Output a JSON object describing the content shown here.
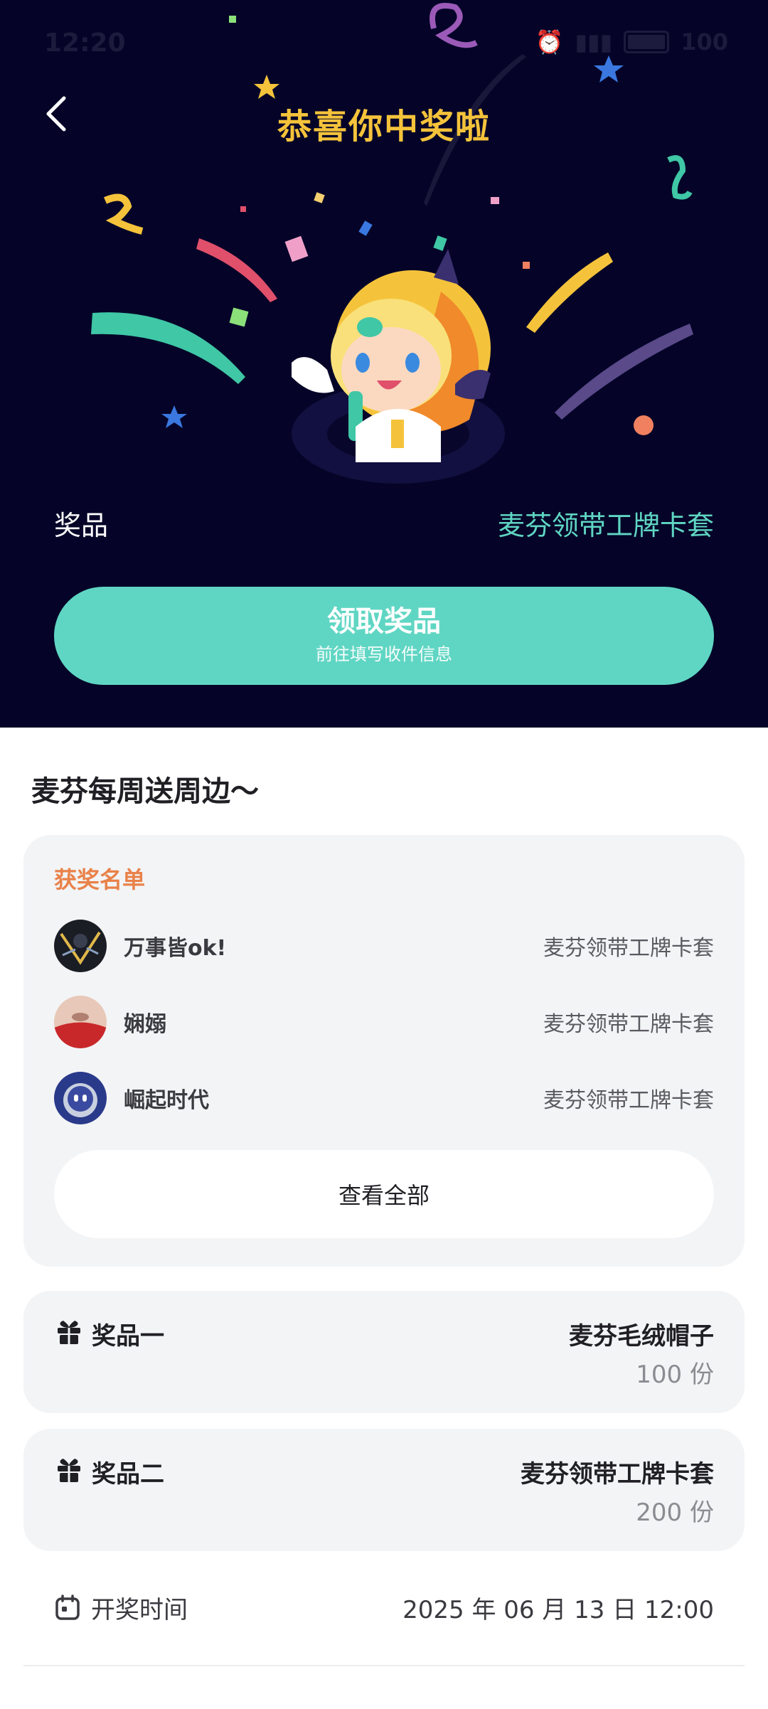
{
  "status_bar": {
    "time": "12:20",
    "battery": "100"
  },
  "hero": {
    "title": "恭喜你中奖啦",
    "prize_label": "奖品",
    "prize_value": "麦芬领带工牌卡套",
    "claim_button": {
      "title": "领取奖品",
      "subtitle": "前往填写收件信息"
    }
  },
  "section": {
    "title": "麦芬每周送周边～"
  },
  "winners": {
    "heading": "获奖名单",
    "items": [
      {
        "name": "万事皆ok!",
        "prize": "麦芬领带工牌卡套"
      },
      {
        "name": "娴嫋",
        "prize": "麦芬领带工牌卡套"
      },
      {
        "name": "崛起时代",
        "prize": "麦芬领带工牌卡套"
      }
    ],
    "view_all": "查看全部"
  },
  "prizes": [
    {
      "label": "奖品一",
      "item": "麦芬毛绒帽子",
      "quantity": "100 份"
    },
    {
      "label": "奖品二",
      "item": "麦芬领带工牌卡套",
      "quantity": "200 份"
    }
  ],
  "draw": {
    "label": "开奖时间",
    "value": "2025 年 06 月 13 日 12:00"
  },
  "colors": {
    "hero_bg": "#050428",
    "accent_teal": "#5fd6c3",
    "title_gold": "#f5c33b",
    "winner_heading": "#e9824a"
  }
}
